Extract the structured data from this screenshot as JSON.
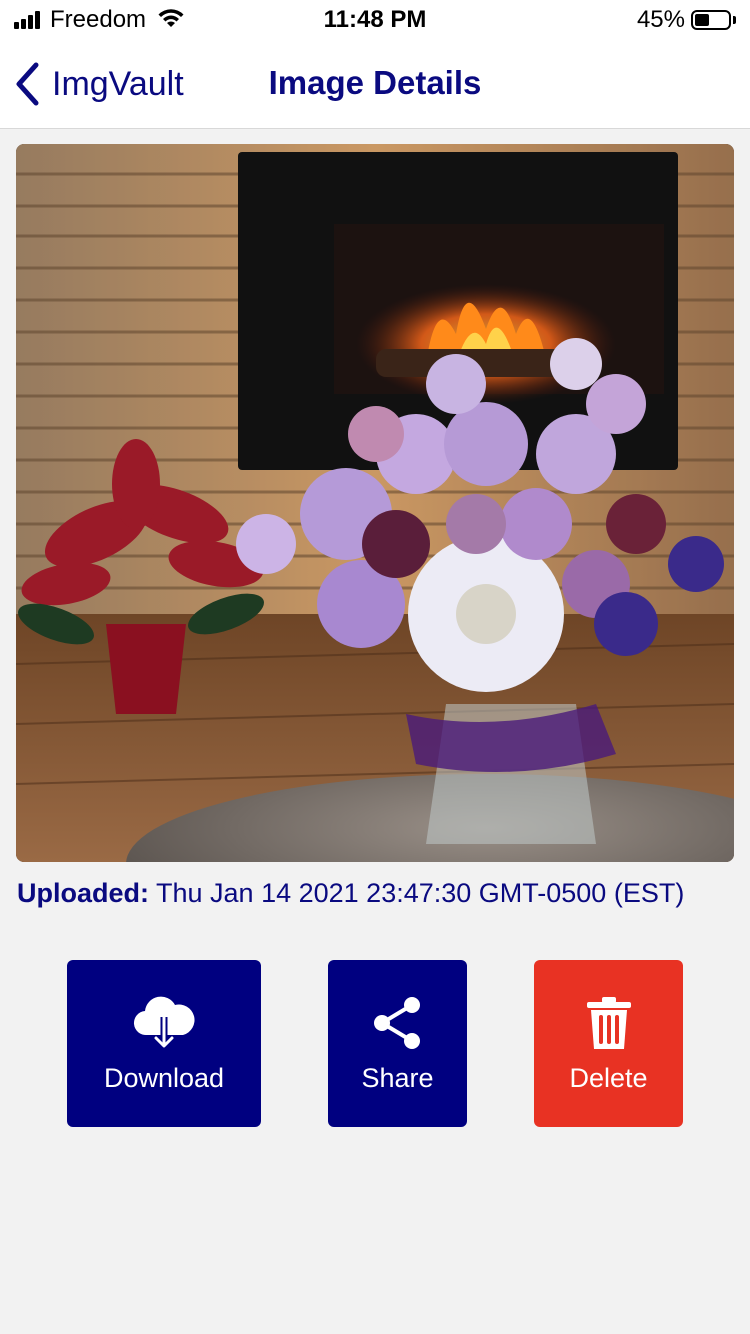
{
  "status_bar": {
    "carrier": "Freedom",
    "time": "11:48 PM",
    "battery_percent": "45%",
    "battery_level": 0.45
  },
  "nav": {
    "back_label": "ImgVault",
    "title": "Image Details"
  },
  "photo": {
    "icon": "photo-image"
  },
  "details": {
    "uploaded_label": "Uploaded:",
    "uploaded_value": "Thu Jan 14 2021 23:47:30 GMT-0500 (EST)"
  },
  "actions": {
    "download_label": "Download",
    "share_label": "Share",
    "delete_label": "Delete"
  },
  "colors": {
    "accent": "#000080",
    "danger": "#e83223",
    "background": "#f2f2f2"
  }
}
